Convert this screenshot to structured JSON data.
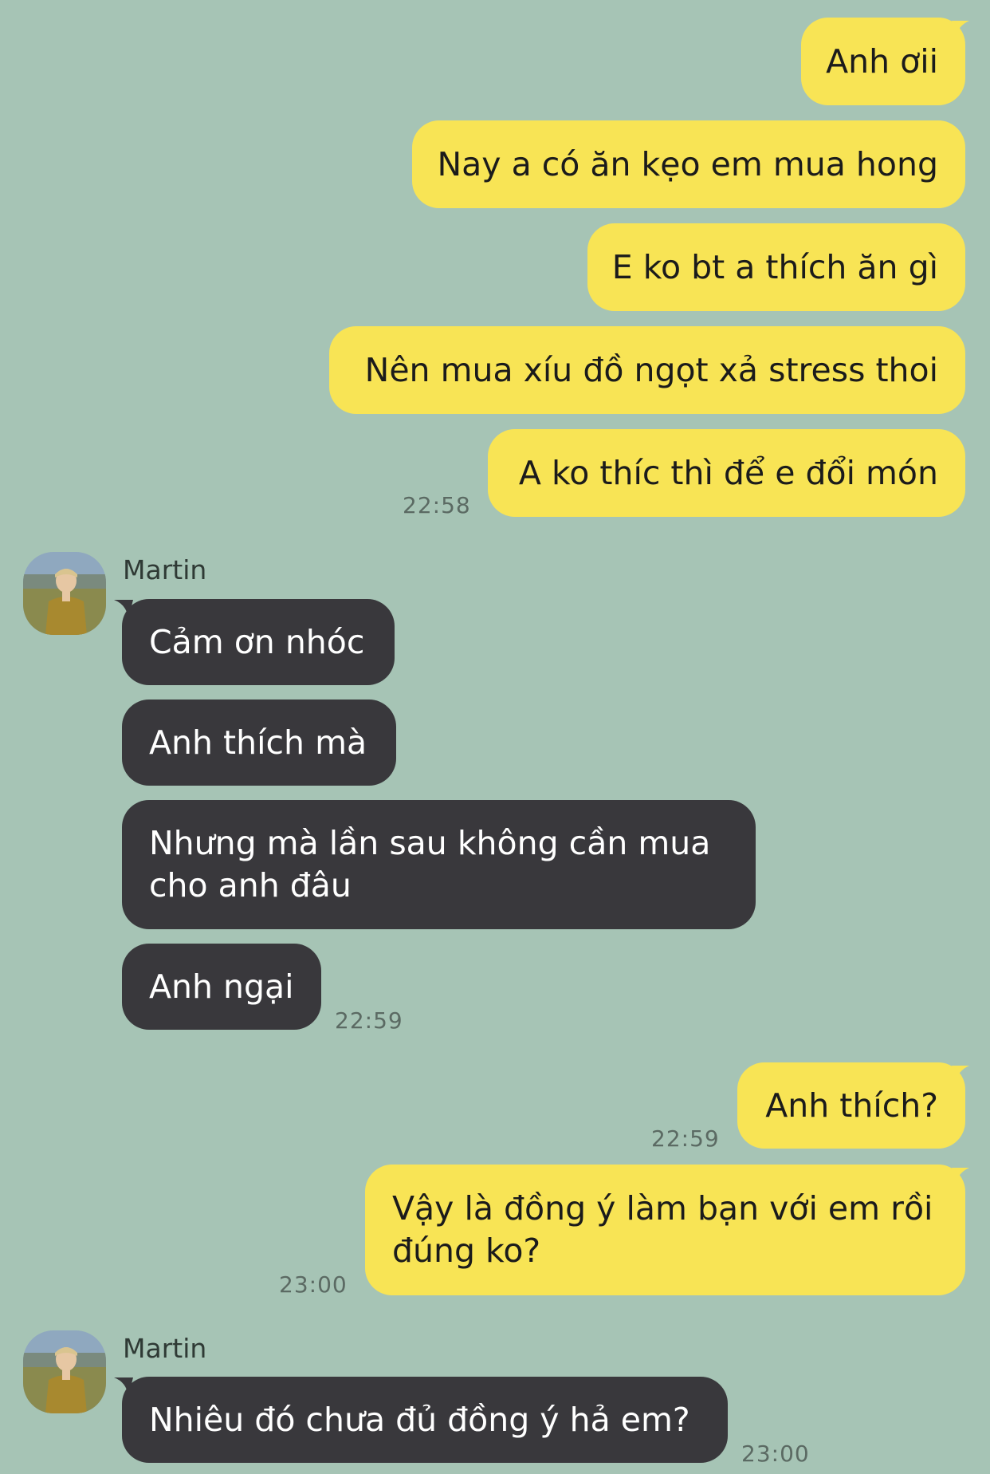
{
  "messages_out_1": [
    "Anh ơii",
    "Nay a có ăn kẹo em mua hong",
    "E ko bt a thích ăn gì",
    "Nên mua xíu đồ ngọt xả stress thoi",
    "A ko thíc thì để e đổi món"
  ],
  "time_out_1": "22:58",
  "sender_name": "Martin",
  "messages_in_1": [
    "Cảm ơn nhóc",
    "Anh thích mà",
    "Nhưng mà lần sau không cần mua cho anh đâu",
    "Anh ngại"
  ],
  "time_in_1": "22:59",
  "messages_out_2": [
    "Anh thích?"
  ],
  "time_out_2": "22:59",
  "messages_out_3": [
    "Vậy là đồng ý làm bạn với em rồi đúng ko?"
  ],
  "time_out_3": "23:00",
  "messages_in_2": [
    "Nhiêu đó chưa đủ đồng ý hả em?"
  ],
  "time_in_2": "23:00",
  "colors": {
    "background": "#a6c4b5",
    "outgoing_bubble": "#f8e455",
    "incoming_bubble": "#39383c"
  },
  "icons": {
    "avatar": "profile-photo"
  }
}
